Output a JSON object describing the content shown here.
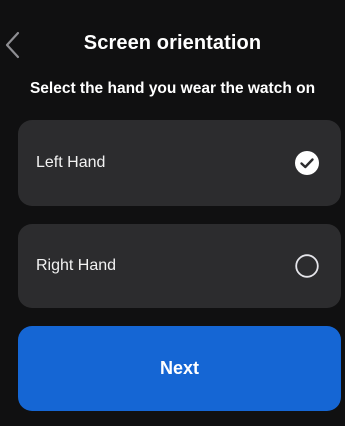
{
  "header": {
    "title": "Screen orientation",
    "back_icon": "chevron-left-icon"
  },
  "subtitle": "Select the hand you wear the watch on",
  "options": [
    {
      "label": "Left Hand",
      "selected": true,
      "icon": "check-circle-icon"
    },
    {
      "label": "Right Hand",
      "selected": false,
      "icon": "empty-circle-icon"
    }
  ],
  "next_button": {
    "label": "Next"
  },
  "colors": {
    "background": "#101011",
    "card": "#2c2c2e",
    "accent": "#1566d4",
    "text": "#ffffff"
  }
}
